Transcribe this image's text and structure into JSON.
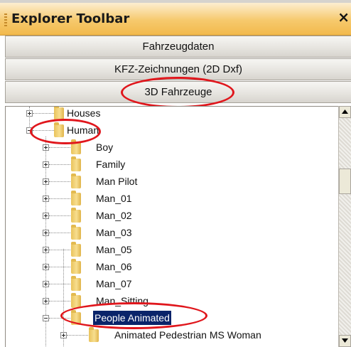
{
  "panel": {
    "title": "Explorer Toolbar",
    "close_glyph": "×"
  },
  "sections": [
    {
      "label": "Fahrzeugdaten"
    },
    {
      "label": "KFZ-Zeichnungen (2D Dxf)"
    },
    {
      "label": "3D Fahrzeuge"
    }
  ],
  "tree": {
    "items": [
      {
        "label": "Houses"
      },
      {
        "label": "Human"
      },
      {
        "label": "Boy"
      },
      {
        "label": "Family"
      },
      {
        "label": "Man Pilot"
      },
      {
        "label": "Man_01"
      },
      {
        "label": "Man_02"
      },
      {
        "label": "Man_03"
      },
      {
        "label": "Man_05"
      },
      {
        "label": "Man_06"
      },
      {
        "label": "Man_07"
      },
      {
        "label": "Man_Sitting"
      },
      {
        "label": "People Animated"
      },
      {
        "label": "Animated Pedestrian MS Woman"
      }
    ],
    "selected_item": "People Animated"
  },
  "colors": {
    "titlebar_gradient_start": "#fdeed1",
    "titlebar_gradient_end": "#f2b94c",
    "selection_background": "#0a246a",
    "highlight_ellipse": "#e0161c",
    "folder_icon": "#f0cf6c"
  }
}
